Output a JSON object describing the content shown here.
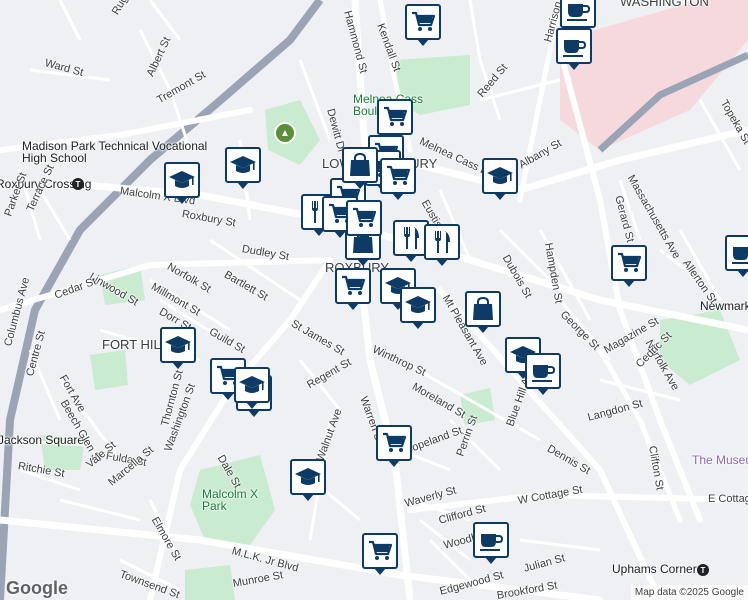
{
  "map": {
    "neighborhood_labels": [
      {
        "text": "ROXBURY"
      },
      {
        "text": "LOWER ROXBURY"
      },
      {
        "text": "FORT HILL"
      },
      {
        "text": "WASHINGTON"
      }
    ],
    "poi_labels": [
      {
        "text": "Madison Park Technical Vocational High School"
      },
      {
        "text": "Melnea Cass Boulevard"
      },
      {
        "text": "Malcolm X Park"
      },
      {
        "text": "Roxbury Crossing"
      },
      {
        "text": "Jackson Square"
      },
      {
        "text": "Newmarket"
      },
      {
        "text": "Uphams Corner"
      },
      {
        "text": "The Museum"
      }
    ],
    "street_labels": [
      "Ruggles St",
      "Ward St",
      "Albert St",
      "Tremont St",
      "Hammond St",
      "Kendall St",
      "Dewitt Dr",
      "Melnea Cass Blvd",
      "Reed St",
      "Albany St",
      "Massachusetts Ave",
      "Gerard St",
      "Allerton St",
      "Topeka St",
      "Malcolm X Blvd",
      "Roxbury St",
      "Dudley St",
      "Bartlett St",
      "Norfolk St",
      "Millmont St",
      "Linwood St",
      "Cedar St",
      "Dorr St",
      "Guild St",
      "Columbus Ave",
      "Parker St",
      "Terrace St",
      "Centre St",
      "Fort Ave",
      "Beech Glen St",
      "Thornton St",
      "Regent St",
      "St James St",
      "Winthrop St",
      "Moreland St",
      "Mt Pleasant Ave",
      "Eustis St",
      "Dubois St",
      "Hampden St",
      "George St",
      "Magazine St",
      "Norfolk Ave",
      "Cedric St",
      "Langdon St",
      "Dennis St",
      "Blue Hill Ave",
      "Clifton St",
      "Warren St",
      "Washington St",
      "Dale St",
      "Fulda St",
      "Vale St",
      "Marcella St",
      "Ritchie St",
      "Elmore St",
      "Townsend St",
      "Copeland St",
      "Perrin St",
      "Waverly St",
      "W Cottage St",
      "E Cottage St",
      "Clifford St",
      "Woodbine St",
      "Julian St",
      "M.L.K. Jr Blvd",
      "Munroe St",
      "Edgewood St",
      "Brookford St",
      "Harrison Ave",
      "Walnut Ave"
    ],
    "markers": [
      {
        "type": "shopping",
        "icon": "shopping-cart-icon"
      },
      {
        "type": "cafe",
        "icon": "coffee-cup-icon"
      },
      {
        "type": "cafe",
        "icon": "coffee-cup-icon"
      },
      {
        "type": "shopping",
        "icon": "shopping-cart-icon"
      },
      {
        "type": "shopping",
        "icon": "shopping-cart-icon"
      },
      {
        "type": "shopping",
        "icon": "shopping-cart-icon"
      },
      {
        "type": "shopping",
        "icon": "shopping-cart-icon"
      },
      {
        "type": "school",
        "icon": "graduation-cap-icon"
      },
      {
        "type": "school",
        "icon": "graduation-cap-icon"
      },
      {
        "type": "school",
        "icon": "graduation-cap-icon"
      },
      {
        "type": "restaurant",
        "icon": "fork-knife-icon"
      },
      {
        "type": "shopping",
        "icon": "shopping-cart-icon"
      },
      {
        "type": "shopping",
        "icon": "shopping-bag-icon"
      },
      {
        "type": "restaurant",
        "icon": "fork-knife-icon"
      },
      {
        "type": "restaurant",
        "icon": "fork-knife-icon"
      },
      {
        "type": "shopping",
        "icon": "shopping-bag-icon"
      },
      {
        "type": "school",
        "icon": "graduation-cap-icon"
      },
      {
        "type": "school",
        "icon": "graduation-cap-icon"
      },
      {
        "type": "shopping",
        "icon": "shopping-bag-icon"
      },
      {
        "type": "shopping",
        "icon": "shopping-cart-icon"
      },
      {
        "type": "shopping",
        "icon": "shopping-cart-icon"
      },
      {
        "type": "cafe",
        "icon": "coffee-cup-icon"
      },
      {
        "type": "school",
        "icon": "graduation-cap-icon"
      },
      {
        "type": "cafe",
        "icon": "coffee-cup-icon"
      },
      {
        "type": "school",
        "icon": "graduation-cap-icon"
      },
      {
        "type": "shopping",
        "icon": "shopping-cart-icon"
      },
      {
        "type": "school",
        "icon": "graduation-cap-icon"
      },
      {
        "type": "school",
        "icon": "graduation-cap-icon"
      },
      {
        "type": "shopping",
        "icon": "shopping-cart-icon"
      },
      {
        "type": "shopping",
        "icon": "shopping-cart-icon"
      },
      {
        "type": "shopping",
        "icon": "shopping-cart-icon"
      },
      {
        "type": "school",
        "icon": "graduation-cap-icon"
      },
      {
        "type": "cafe",
        "icon": "coffee-cup-icon"
      },
      {
        "type": "shopping",
        "icon": "shopping-cart-icon"
      }
    ],
    "colors": {
      "background": "#eef0f4",
      "road": "#ffffff",
      "highway": "#8e9aab",
      "park": "#c9ebcf",
      "marker_border": "#0d3b66",
      "marker_icon": "#0d3b66",
      "commercial": "#f6d9dc"
    },
    "attribution": "Map data ©2025 Google",
    "logo_text": "Google"
  }
}
